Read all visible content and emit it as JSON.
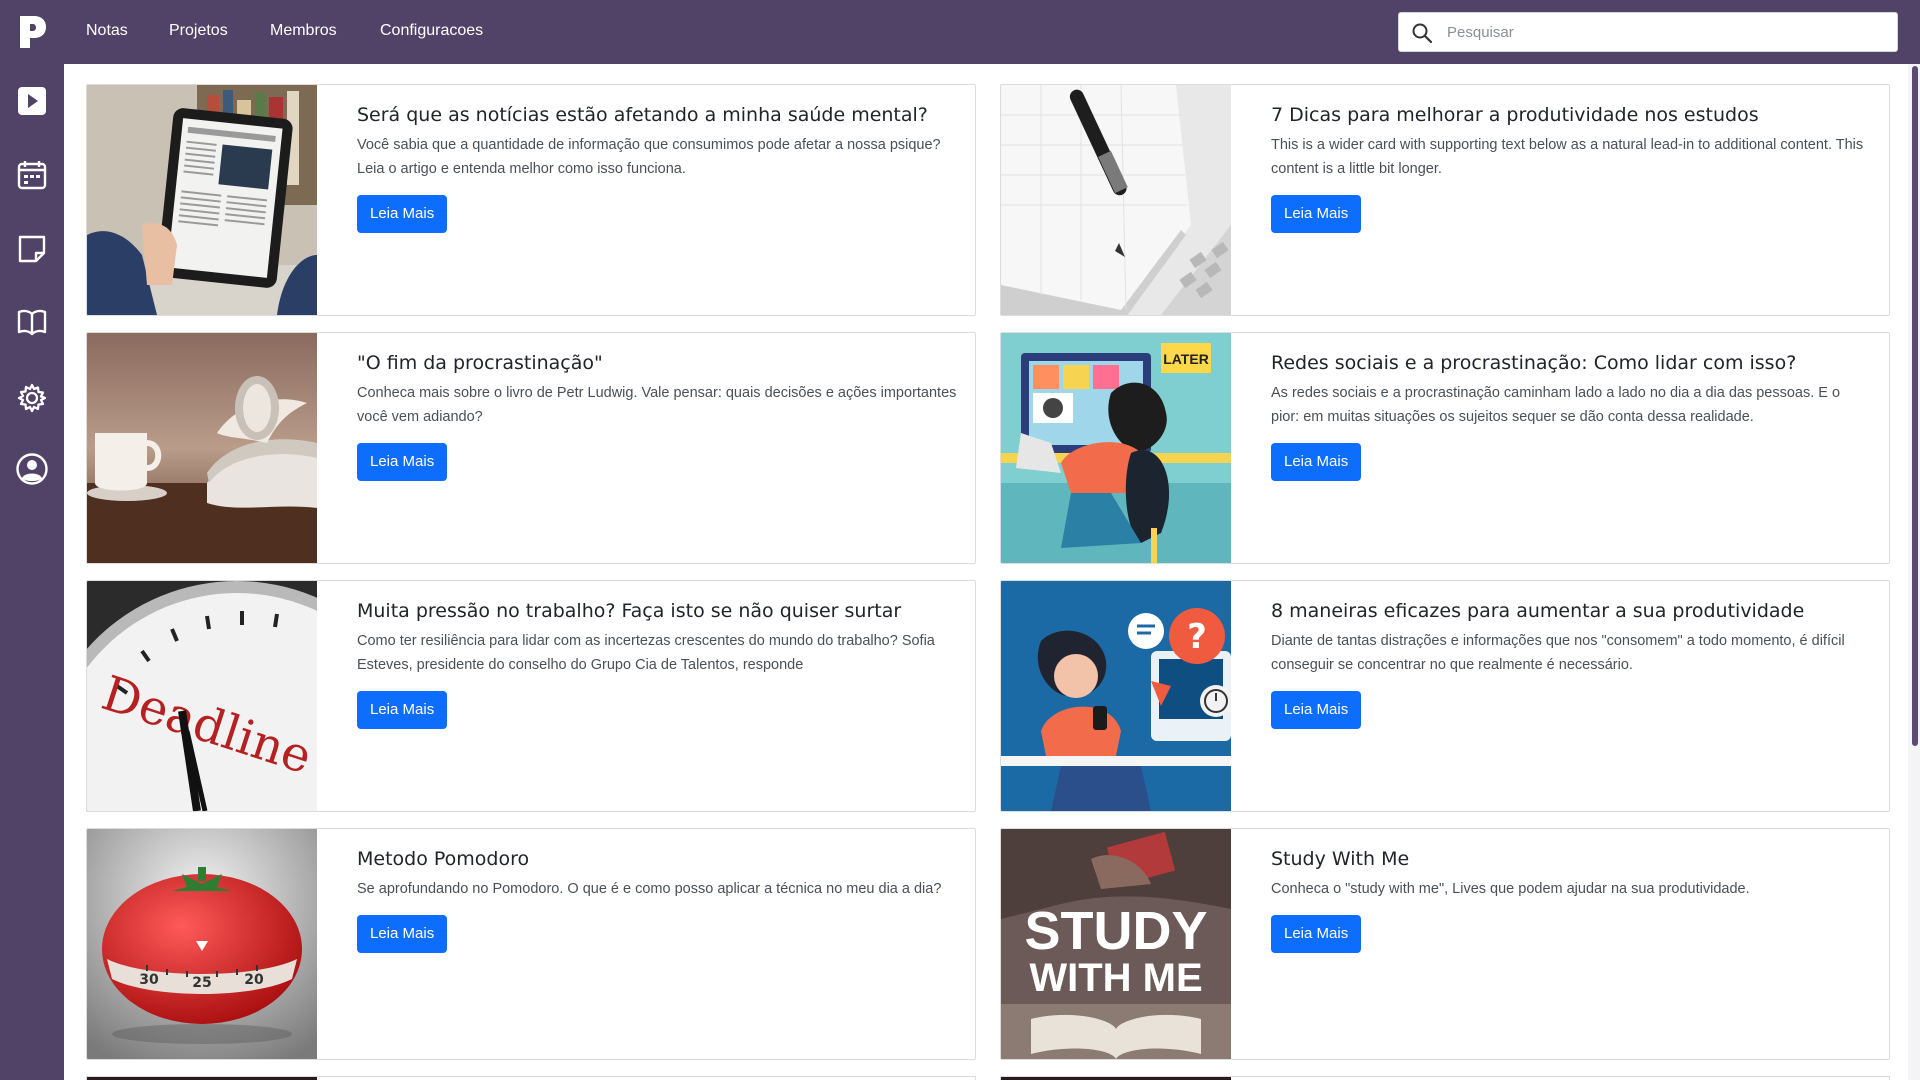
{
  "nav": {
    "links": [
      "Notas",
      "Projetos",
      "Membros",
      "Configuracoes"
    ],
    "search_placeholder": "Pesquisar"
  },
  "sidebar": {
    "icons": [
      "play-icon",
      "calendar-icon",
      "sticky-note-icon",
      "book-icon",
      "gear-icon",
      "user-circle-icon"
    ]
  },
  "cards": [
    {
      "title": "Será que as notícias estão afetando a minha saúde mental?",
      "text": "Você sabia que a quantidade de informação que consumimos pode afetar a nossa psique? Leia o artigo e entenda melhor como isso funciona.",
      "button": "Leia Mais"
    },
    {
      "title": "7 Dicas para melhorar a produtividade nos estudos",
      "text": "This is a wider card with supporting text below as a natural lead-in to additional content. This content is a little bit longer.",
      "button": "Leia Mais"
    },
    {
      "title": "\"O fim da procrastinação\"",
      "text": "Conheca mais sobre o livro de Petr Ludwig. Vale pensar: quais decisões e ações importantes você vem adiando?",
      "button": "Leia Mais"
    },
    {
      "title": "Redes sociais e a procrastinação: Como lidar com isso?",
      "text": "As redes sociais e a procrastinação caminham lado a lado no dia a dia das pessoas. E o pior: em muitas situações os sujeitos sequer se dão conta dessa realidade.",
      "button": "Leia Mais"
    },
    {
      "title": "Muita pressão no trabalho? Faça isto se não quiser surtar",
      "text": "Como ter resiliência para lidar com as incertezas crescentes do mundo do trabalho? Sofia Esteves, presidente do conselho do Grupo Cia de Talentos, responde",
      "button": "Leia Mais"
    },
    {
      "title": "8 maneiras eficazes para aumentar a sua produtividade",
      "text": "Diante de tantas distrações e informações que nos \"consomem\" a todo momento, é difícil conseguir se concentrar no que realmente é necessário.",
      "button": "Leia Mais"
    },
    {
      "title": "Metodo Pomodoro",
      "text": "Se aprofundando no Pomodoro. O que é e como posso aplicar a técnica no meu dia a dia?",
      "button": "Leia Mais"
    },
    {
      "title": "Study With Me",
      "text": "Conheca o \"study with me\", Lives que podem ajudar na sua produtividade.",
      "button": "Leia Mais"
    }
  ],
  "thumbs": {
    "deadline_text": "Deadline",
    "later_text": "LATER",
    "study_line1": "STUDY",
    "study_line2": "WITH ME",
    "timer_ticks": [
      "30",
      "25",
      "20"
    ]
  },
  "colors": {
    "brand": "#514267",
    "primary_button": "#0d6efd"
  }
}
